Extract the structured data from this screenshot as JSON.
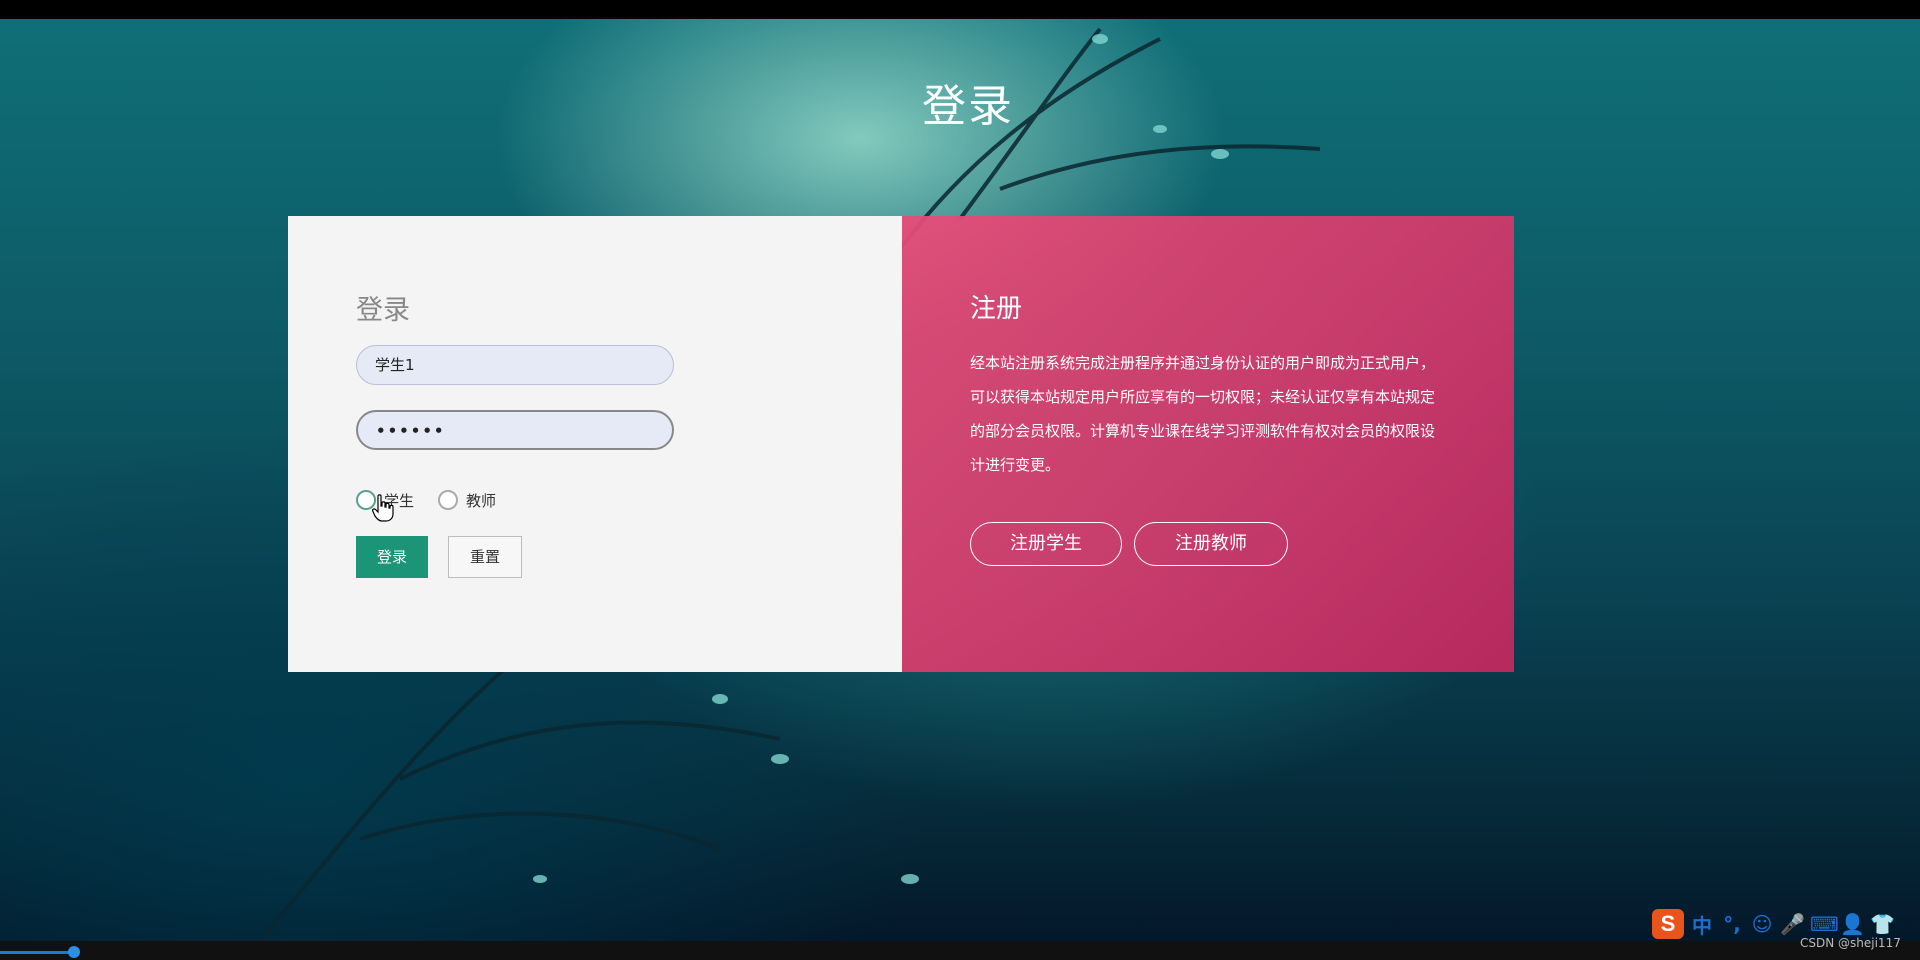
{
  "page": {
    "title": "登录"
  },
  "login": {
    "heading": "登录",
    "username_value": "学生1",
    "password_masked": "••••••",
    "roles": [
      {
        "label": "学生",
        "checked": true
      },
      {
        "label": "教师",
        "checked": false
      }
    ],
    "login_button": "登录",
    "reset_button": "重置"
  },
  "register": {
    "heading": "注册",
    "description": "经本站注册系统完成注册程序并通过身份认证的用户即成为正式用户，可以获得本站规定用户所应享有的一切权限；未经认证仅享有本站规定的部分会员权限。计算机专业课在线学习评测软件有权对会员的权限设计进行变更。",
    "student_button": "注册学生",
    "teacher_button": "注册教师"
  },
  "ime": {
    "logo": "S",
    "mode": "中",
    "punct": "°,",
    "emoji": "☺",
    "mic": "🎤",
    "keyboard": "⌨",
    "user": "👤",
    "skin": "👕"
  },
  "watermark": "CSDN @sheji117",
  "colors": {
    "login_button": "#1b9477",
    "register_panel": "#d83a72",
    "login_panel": "#f4f4f4"
  }
}
